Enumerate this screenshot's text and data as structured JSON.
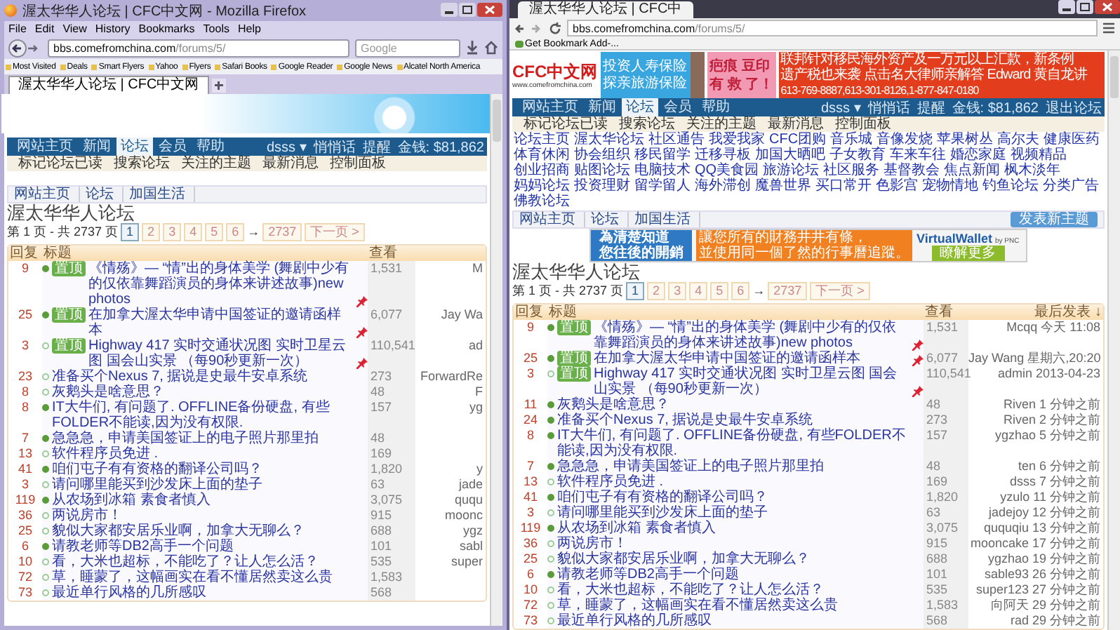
{
  "left_window": {
    "title": "渥太华华人论坛 | CFC中文网 - Mozilla Firefox",
    "menu": [
      "File",
      "Edit",
      "View",
      "History",
      "Bookmarks",
      "Tools",
      "Help"
    ],
    "url_host": "bbs.comefromchina.com",
    "url_path": "/forums/5/",
    "search_placeholder": "Google",
    "bookmarks": [
      "Most Visited",
      "Deals",
      "Smart Flyers",
      "Yahoo",
      "Flyers",
      "Safari Books",
      "Google Reader",
      "Google News",
      "Alcatel North America"
    ],
    "tabs": [
      {
        "label": "渥太华华人论坛 | CFC中文网",
        "selected": true
      }
    ],
    "forum": {
      "nav": [
        {
          "label": "网站主页",
          "selected": false
        },
        {
          "label": "新闻",
          "selected": false
        },
        {
          "label": "论坛",
          "selected": true
        },
        {
          "label": "会员",
          "selected": false
        },
        {
          "label": "帮助",
          "selected": false
        }
      ],
      "user_links": [
        "dsss ▾",
        "悄悄话",
        "提醒",
        "金钱: $81,862"
      ],
      "subnav": [
        "标记论坛已读",
        "搜索论坛",
        "关注的主题",
        "最新消息",
        "控制面板"
      ],
      "breadcrumb": [
        "网站主页",
        "论坛",
        "加国生活"
      ],
      "heading": "渥太华华人论坛",
      "pagination": {
        "summary": "第 1 页 - 共 2737 页",
        "pages": [
          {
            "label": "1",
            "selected": true
          },
          {
            "label": "2",
            "selected": false
          },
          {
            "label": "3",
            "selected": false
          },
          {
            "label": "4",
            "selected": false
          },
          {
            "label": "5",
            "selected": false
          },
          {
            "label": "6",
            "selected": false
          }
        ],
        "arrow": "→",
        "last": "2737",
        "next": "下一页 >"
      },
      "columns": [
        "回复",
        "标题",
        "查看"
      ],
      "rows": [
        {
          "replies": "9",
          "tag": "置顶",
          "title": "《情殇》— “情”出的身体美学 (舞剧中少有的仅依靠舞蹈演员的身体来讲述故事)new photos",
          "unread": true,
          "sticky": true,
          "views": "1,531",
          "last": "M"
        },
        {
          "replies": "25",
          "tag": "置顶",
          "title": "在加拿大渥太华申请中国签证的邀请函样本",
          "unread": true,
          "sticky": true,
          "views": "6,077",
          "last": "Jay Wa"
        },
        {
          "replies": "3",
          "tag": "置顶",
          "title": "Highway 417 实时交通状况图 实时卫星云图 国会山实景 （每90秒更新一次）",
          "unread": false,
          "sticky": true,
          "views": "110,541",
          "last": "ad"
        },
        {
          "replies": "23",
          "title": "准备买个Nexus 7, 据说是史最牛安卓系统",
          "unread": false,
          "sticky": false,
          "views": "273",
          "last": "ForwardRe"
        },
        {
          "replies": "8",
          "title": "灰鹅头是啥意思？",
          "unread": false,
          "sticky": false,
          "views": "48",
          "last": "F"
        },
        {
          "replies": "8",
          "title": "IT大牛们, 有问题了. OFFLINE备份硬盘, 有些FOLDER不能读,因为没有权限.",
          "unread": true,
          "sticky": false,
          "views": "157",
          "last": "yg"
        },
        {
          "replies": "7",
          "title": "急急急，申请美国签证上的电子照片那里拍",
          "unread": true,
          "sticky": false,
          "views": "48"
        },
        {
          "replies": "13",
          "title": "软件程序员免进 .",
          "unread": false,
          "sticky": false,
          "views": "169"
        },
        {
          "replies": "41",
          "title": "咱们屯子有有资格的翻译公司吗？",
          "unread": true,
          "sticky": false,
          "views": "1,820",
          "last": "y"
        },
        {
          "replies": "3",
          "title": "请问哪里能买到沙发床上面的垫子",
          "unread": false,
          "sticky": false,
          "views": "63",
          "last": "jade"
        },
        {
          "replies": "119",
          "title": "从农场到冰箱 素食者慎入",
          "unread": true,
          "sticky": false,
          "views": "3,075",
          "last": "ququ"
        },
        {
          "replies": "36",
          "title": "两说房市！",
          "unread": false,
          "sticky": false,
          "views": "915",
          "last": "moonc"
        },
        {
          "replies": "25",
          "title": "貌似大家都安居乐业啊，加拿大无聊么？",
          "unread": false,
          "sticky": false,
          "views": "688",
          "last": "ygz"
        },
        {
          "replies": "6",
          "title": "请教老师等DB2高手一个问题",
          "unread": true,
          "sticky": false,
          "views": "101",
          "last": "sabl"
        },
        {
          "replies": "10",
          "title": "看，大米也超标，不能吃了？让人怎么活？",
          "unread": false,
          "sticky": false,
          "views": "535",
          "last": "super"
        },
        {
          "replies": "72",
          "title": "草，睡蒙了，这幅画实在看不懂居然卖这么贵",
          "unread": false,
          "sticky": false,
          "views": "1,583"
        },
        {
          "replies": "73",
          "title": "最近单行风格的几所感叹",
          "unread": false,
          "sticky": false,
          "views": "568"
        }
      ]
    }
  },
  "right_window": {
    "tabs": [
      {
        "label": "渥太华华人论坛 | CFC中",
        "selected": true
      }
    ],
    "url_host": "bbs.comefromchina.com",
    "url_path": "/forums/5/",
    "bookmarks": [
      "Get Bookmark Add-..."
    ],
    "banner": {
      "logo": "CFC中文网",
      "logo_url": "www.comefromchina.com",
      "ad1": [
        "投资人寿保险",
        "探亲旅游保险"
      ],
      "ad2": [
        "疤痕 豆印",
        "有 救 了！"
      ],
      "ad3": [
        "联邦针对移民海外资产及一万元以上汇款，新条例",
        "遗产税也来袭 点击名大律师亲解答 Edward 黄自龙讲",
        "613-769-8887,613-301-8126,1-877-847-0180"
      ]
    },
    "forum": {
      "nav": [
        {
          "label": "网站主页",
          "selected": false
        },
        {
          "label": "新闻",
          "selected": false
        },
        {
          "label": "论坛",
          "selected": true
        },
        {
          "label": "会员",
          "selected": false
        },
        {
          "label": "帮助",
          "selected": false
        }
      ],
      "user_links": [
        "dsss ▾",
        "悄悄话",
        "提醒",
        "金钱: $81,862",
        "退出论坛"
      ],
      "subnav": [
        "标记论坛已读",
        "搜索论坛",
        "关注的主题",
        "最新消息",
        "控制面板"
      ],
      "categories": [
        "论坛主页",
        "渥太华论坛",
        "社区通告",
        "我爱我家",
        "CFC团购",
        "音乐城",
        "音像发烧",
        "苹果树丛",
        "高尔夫",
        "健康医药",
        "体育休闲",
        "协会组织",
        "移民留学",
        "迁移寻板",
        "加国大晒吧",
        "子女教育",
        "车来车往",
        "婚恋家庭",
        "视频精品",
        "创业招商",
        "贴图论坛",
        "电脑技术",
        "QQ美食园",
        "旅游论坛",
        "社区服务",
        "基督教会",
        "焦点新闻",
        "枫木淡年",
        "妈妈论坛",
        "投资理财",
        "留学留人",
        "海外滞创",
        "魔兽世界",
        "买口常开",
        "色影宫",
        "宠物情地",
        "钓鱼论坛",
        "分类广告",
        "佛教论坛"
      ],
      "breadcrumb": [
        "网站主页",
        "论坛",
        "加国生活"
      ],
      "post_button": "发表新主题",
      "ad": {
        "headline": [
          "為清楚知道",
          "您往後的開銷"
        ],
        "body": [
          "讓您所有的財務井井有條，",
          "並使用同一個了然的行事曆追蹤。"
        ],
        "brand": "VirtualWallet",
        "brand_sub": "by PNC",
        "cta": "瞭解更多"
      },
      "heading": "渥太华华人论坛",
      "pagination": {
        "summary": "第 1 页 - 共 2737 页",
        "pages": [
          {
            "label": "1",
            "selected": true
          },
          {
            "label": "2",
            "selected": false
          },
          {
            "label": "3",
            "selected": false
          },
          {
            "label": "4",
            "selected": false
          },
          {
            "label": "5",
            "selected": false
          },
          {
            "label": "6",
            "selected": false
          }
        ],
        "arrow": "→",
        "last": "2737",
        "next": "下一页 >"
      },
      "columns": [
        "回复",
        "标题",
        "查看",
        "最后发表 ↓"
      ],
      "rows": [
        {
          "replies": "9",
          "tag": "置顶",
          "title": "《情殇》— “情”出的身体美学 (舞剧中少有的仅依靠舞蹈演员的身体来讲述故事)new photos",
          "unread": true,
          "sticky": true,
          "views": "1,531",
          "last": "Mcqq 今天 11:08"
        },
        {
          "replies": "25",
          "tag": "置顶",
          "title": "在加拿大渥太华申请中国签证的邀请函样本",
          "unread": true,
          "sticky": true,
          "views": "6,077",
          "last": "Jay Wang 星期六,20:20"
        },
        {
          "replies": "3",
          "tag": "置顶",
          "title": "Highway 417 实时交通状况图 实时卫星云图 国会山实景 （每90秒更新一次）",
          "unread": false,
          "sticky": true,
          "views": "110,541",
          "last": "admin 2013-04-23"
        },
        {
          "replies": "11",
          "title": "灰鹅头是啥意思？",
          "unread": true,
          "sticky": false,
          "views": "48",
          "last": "Riven 1 分钟之前"
        },
        {
          "replies": "24",
          "title": "准备买个Nexus 7, 据说是史最牛安卓系统",
          "unread": true,
          "sticky": false,
          "views": "273",
          "last": "Riven 2 分钟之前"
        },
        {
          "replies": "8",
          "title": "IT大牛们, 有问题了. OFFLINE备份硬盘, 有些FOLDER不能读,因为没有权限.",
          "unread": true,
          "sticky": false,
          "views": "157",
          "last": "ygzhao 5 分钟之前"
        },
        {
          "replies": "7",
          "title": "急急急，申请美国签证上的电子照片那里拍",
          "unread": true,
          "sticky": false,
          "views": "48",
          "last": "ten 6 分钟之前"
        },
        {
          "replies": "13",
          "title": "软件程序员免进 .",
          "unread": false,
          "sticky": false,
          "views": "169",
          "last": "dsss 7 分钟之前"
        },
        {
          "replies": "41",
          "title": "咱们屯子有有资格的翻译公司吗？",
          "unread": true,
          "sticky": false,
          "views": "1,820",
          "last": "yzulo 11 分钟之前"
        },
        {
          "replies": "3",
          "title": "请问哪里能买到沙发床上面的垫子",
          "unread": false,
          "sticky": false,
          "views": "63",
          "last": "jadejoy 12 分钟之前"
        },
        {
          "replies": "119",
          "title": "从农场到冰箱 素食者慎入",
          "unread": true,
          "sticky": false,
          "views": "3,075",
          "last": "ququqiu 13 分钟之前"
        },
        {
          "replies": "36",
          "title": "两说房市！",
          "unread": false,
          "sticky": false,
          "views": "915",
          "last": "mooncake 17 分钟之前"
        },
        {
          "replies": "25",
          "title": "貌似大家都安居乐业啊，加拿大无聊么？",
          "unread": false,
          "sticky": false,
          "views": "688",
          "last": "ygzhao 19 分钟之前"
        },
        {
          "replies": "6",
          "title": "请教老师等DB2高手一个问题",
          "unread": true,
          "sticky": false,
          "views": "101",
          "last": "sable93 26 分钟之前"
        },
        {
          "replies": "10",
          "title": "看，大米也超标，不能吃了？让人怎么活？",
          "unread": false,
          "sticky": false,
          "views": "535",
          "last": "super123 27 分钟之前"
        },
        {
          "replies": "72",
          "title": "草，睡蒙了，这幅画实在看不懂居然卖这么贵",
          "unread": false,
          "sticky": false,
          "views": "1,583",
          "last": "向阿天 29 分钟之前"
        },
        {
          "replies": "73",
          "title": "最近单行风格的几所感叹",
          "unread": false,
          "sticky": false,
          "views": "568",
          "last": "rad 29 分钟之前"
        }
      ]
    }
  }
}
